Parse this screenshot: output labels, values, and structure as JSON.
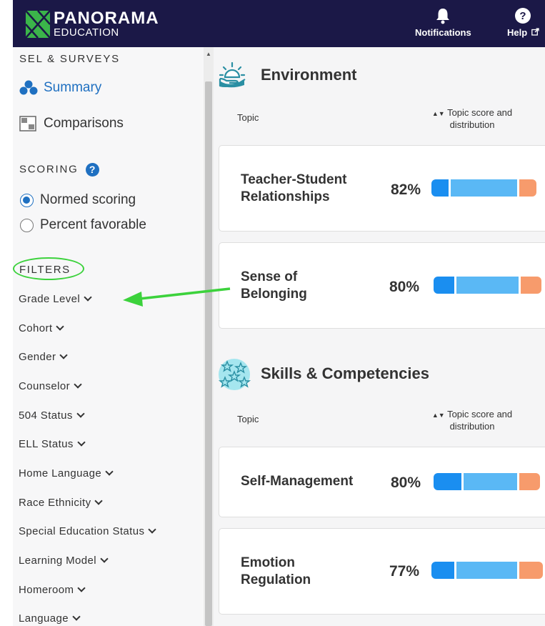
{
  "header": {
    "logo_name": "PANORAMA",
    "logo_sub": "EDUCATION",
    "notifications_label": "Notifications",
    "help_label": "Help",
    "bg_color": "#1b1847"
  },
  "sidebar": {
    "section_sel": "SEL & SURVEYS",
    "nav": [
      {
        "label": "Summary",
        "icon": "dots-icon",
        "active": true
      },
      {
        "label": "Comparisons",
        "icon": "grid-icon",
        "active": false
      }
    ],
    "section_scoring": "SCORING",
    "scoring_help": "?",
    "scoring_options": [
      {
        "label": "Normed scoring",
        "selected": true
      },
      {
        "label": "Percent favorable",
        "selected": false
      }
    ],
    "section_filters": "FILTERS",
    "filters": [
      "Grade Level",
      "Cohort",
      "Gender",
      "Counselor",
      "504 Status",
      "ELL Status",
      "Home Language",
      "Race Ethnicity",
      "Special Education Status",
      "Learning Model",
      "Homeroom",
      "Language"
    ]
  },
  "main": {
    "sections": [
      {
        "title": "Environment",
        "icon": "sun-hand-icon",
        "col_topic": "Topic",
        "col_score": "Topic score and distribution",
        "topics": [
          {
            "label": "Teacher-Student Relationships",
            "score": "82%",
            "dist": [
              0.16,
              0.62,
              0.16
            ]
          },
          {
            "label": "Sense of Belonging",
            "score": "80%",
            "dist": [
              0.19,
              0.58,
              0.19
            ]
          }
        ]
      },
      {
        "title": "Skills & Competencies",
        "icon": "stars-icon",
        "col_topic": "Topic",
        "col_score": "Topic score and distribution",
        "topics": [
          {
            "label": "Self-Management",
            "score": "80%",
            "dist": [
              0.26,
              0.5,
              0.19
            ]
          },
          {
            "label": "Emotion Regulation",
            "score": "77%",
            "dist": [
              0.21,
              0.57,
              0.22
            ]
          }
        ]
      }
    ]
  },
  "colors": {
    "accent": "#1f70c1",
    "unfavorable": "#1a8ef0",
    "neutral": "#5ab8f5",
    "favorable": "#f79b6c",
    "annotation": "#3cd23c"
  }
}
